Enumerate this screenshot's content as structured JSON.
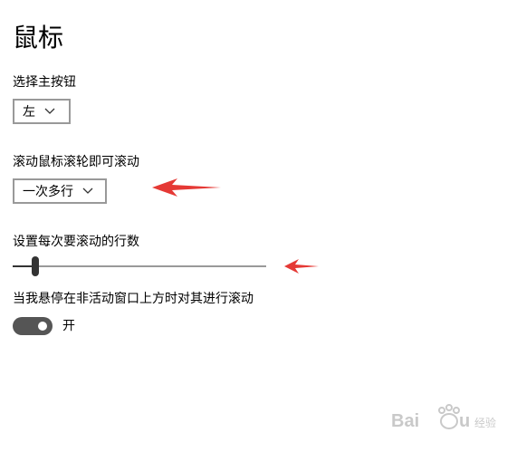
{
  "page": {
    "title": "鼠标"
  },
  "primary_button": {
    "label": "选择主按钮",
    "selected": "左"
  },
  "wheel_scroll": {
    "label": "滚动鼠标滚轮即可滚动",
    "selected": "一次多行"
  },
  "lines_to_scroll": {
    "label": "设置每次要滚动的行数",
    "value_fraction": 0.09
  },
  "inactive_scroll": {
    "label": "当我悬停在非活动窗口上方时对其进行滚动",
    "state_label": "开",
    "on": true
  },
  "annotation_color": "#e53935",
  "watermark": {
    "logo_text": "Baidu 经验"
  }
}
